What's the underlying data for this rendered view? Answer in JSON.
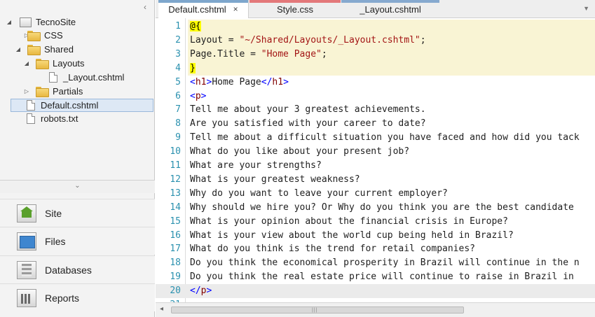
{
  "sidebar": {
    "tree": [
      {
        "label": "TecnoSite",
        "icon": "site-icon",
        "expanded": true
      },
      {
        "label": "CSS",
        "icon": "folder-icon",
        "expanded": false
      },
      {
        "label": "Shared",
        "icon": "folder-icon",
        "expanded": true
      },
      {
        "label": "Layouts",
        "icon": "folder-icon",
        "expanded": true
      },
      {
        "label": "_Layout.cshtml",
        "icon": "file-icon"
      },
      {
        "label": "Partials",
        "icon": "folder-icon",
        "expanded": false
      },
      {
        "label": "Default.cshtml",
        "icon": "file-icon",
        "selected": true
      },
      {
        "label": "robots.txt",
        "icon": "file-icon"
      }
    ],
    "nav": [
      {
        "label": "Site",
        "icon": "site-home-icon"
      },
      {
        "label": "Files",
        "icon": "files-icon"
      },
      {
        "label": "Databases",
        "icon": "databases-icon"
      },
      {
        "label": "Reports",
        "icon": "reports-icon"
      }
    ]
  },
  "tabs": [
    {
      "label": "Default.cshtml",
      "close": "×",
      "active": true,
      "color": "#7ea6cc"
    },
    {
      "label": "Style.css",
      "color": "#e3787a"
    },
    {
      "label": "_Layout.cshtml",
      "color": "#86a9cf"
    }
  ],
  "editor": {
    "lines": [
      {
        "n": "1",
        "t": "@{"
      },
      {
        "n": "2",
        "t": "Layout = \"~/Shared/Layouts/_Layout.cshtml\";"
      },
      {
        "n": "3",
        "t": "Page.Title = \"Home Page\";"
      },
      {
        "n": "4",
        "t": "}"
      },
      {
        "n": "5",
        "t": "<h1>Home Page</h1>"
      },
      {
        "n": "6",
        "t": "<p>"
      },
      {
        "n": "7",
        "t": "Tell me about your 3 greatest achievements."
      },
      {
        "n": "8",
        "t": "Are you satisfied with your career to date?"
      },
      {
        "n": "9",
        "t": "Tell me about a difficult situation you have faced and how did you tack"
      },
      {
        "n": "10",
        "t": "What do you like about your present job?"
      },
      {
        "n": "11",
        "t": "What are your strengths?"
      },
      {
        "n": "12",
        "t": "What is your greatest weakness?"
      },
      {
        "n": "13",
        "t": "Why do you want to leave your current employer?"
      },
      {
        "n": "14",
        "t": "Why should we hire you? Or Why do you think you are the best candidate"
      },
      {
        "n": "15",
        "t": "What is your opinion about the financial crisis in Europe?"
      },
      {
        "n": "16",
        "t": "What is your view about the world cup being held in Brazil?"
      },
      {
        "n": "17",
        "t": "What do you think is the trend for retail companies?"
      },
      {
        "n": "18",
        "t": "Do you think the economical prosperity in Brazil will continue in the n"
      },
      {
        "n": "19",
        "t": "Do you think the real estate price will continue to raise in Brazil in"
      },
      {
        "n": "20",
        "t": "</p>"
      },
      {
        "n": "21",
        "t": ""
      }
    ]
  }
}
